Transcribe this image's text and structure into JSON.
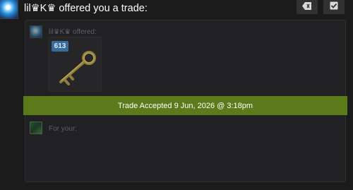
{
  "header": {
    "title": "lil♛K♛ offered you a trade:"
  },
  "toolbar": {
    "buttons": [
      {
        "icon": "erase-tag-icon"
      },
      {
        "icon": "checkbox-check-icon"
      }
    ]
  },
  "offer": {
    "label": "lil♛K♛ offered:",
    "item": {
      "name_icon": "key-icon",
      "count": "613",
      "badge_color": "#3a6b9d"
    }
  },
  "status": {
    "text": "Trade Accepted 9 Jun, 2026 @ 3:18pm",
    "color": "#5b7a1a"
  },
  "yours": {
    "label": "For your:"
  }
}
